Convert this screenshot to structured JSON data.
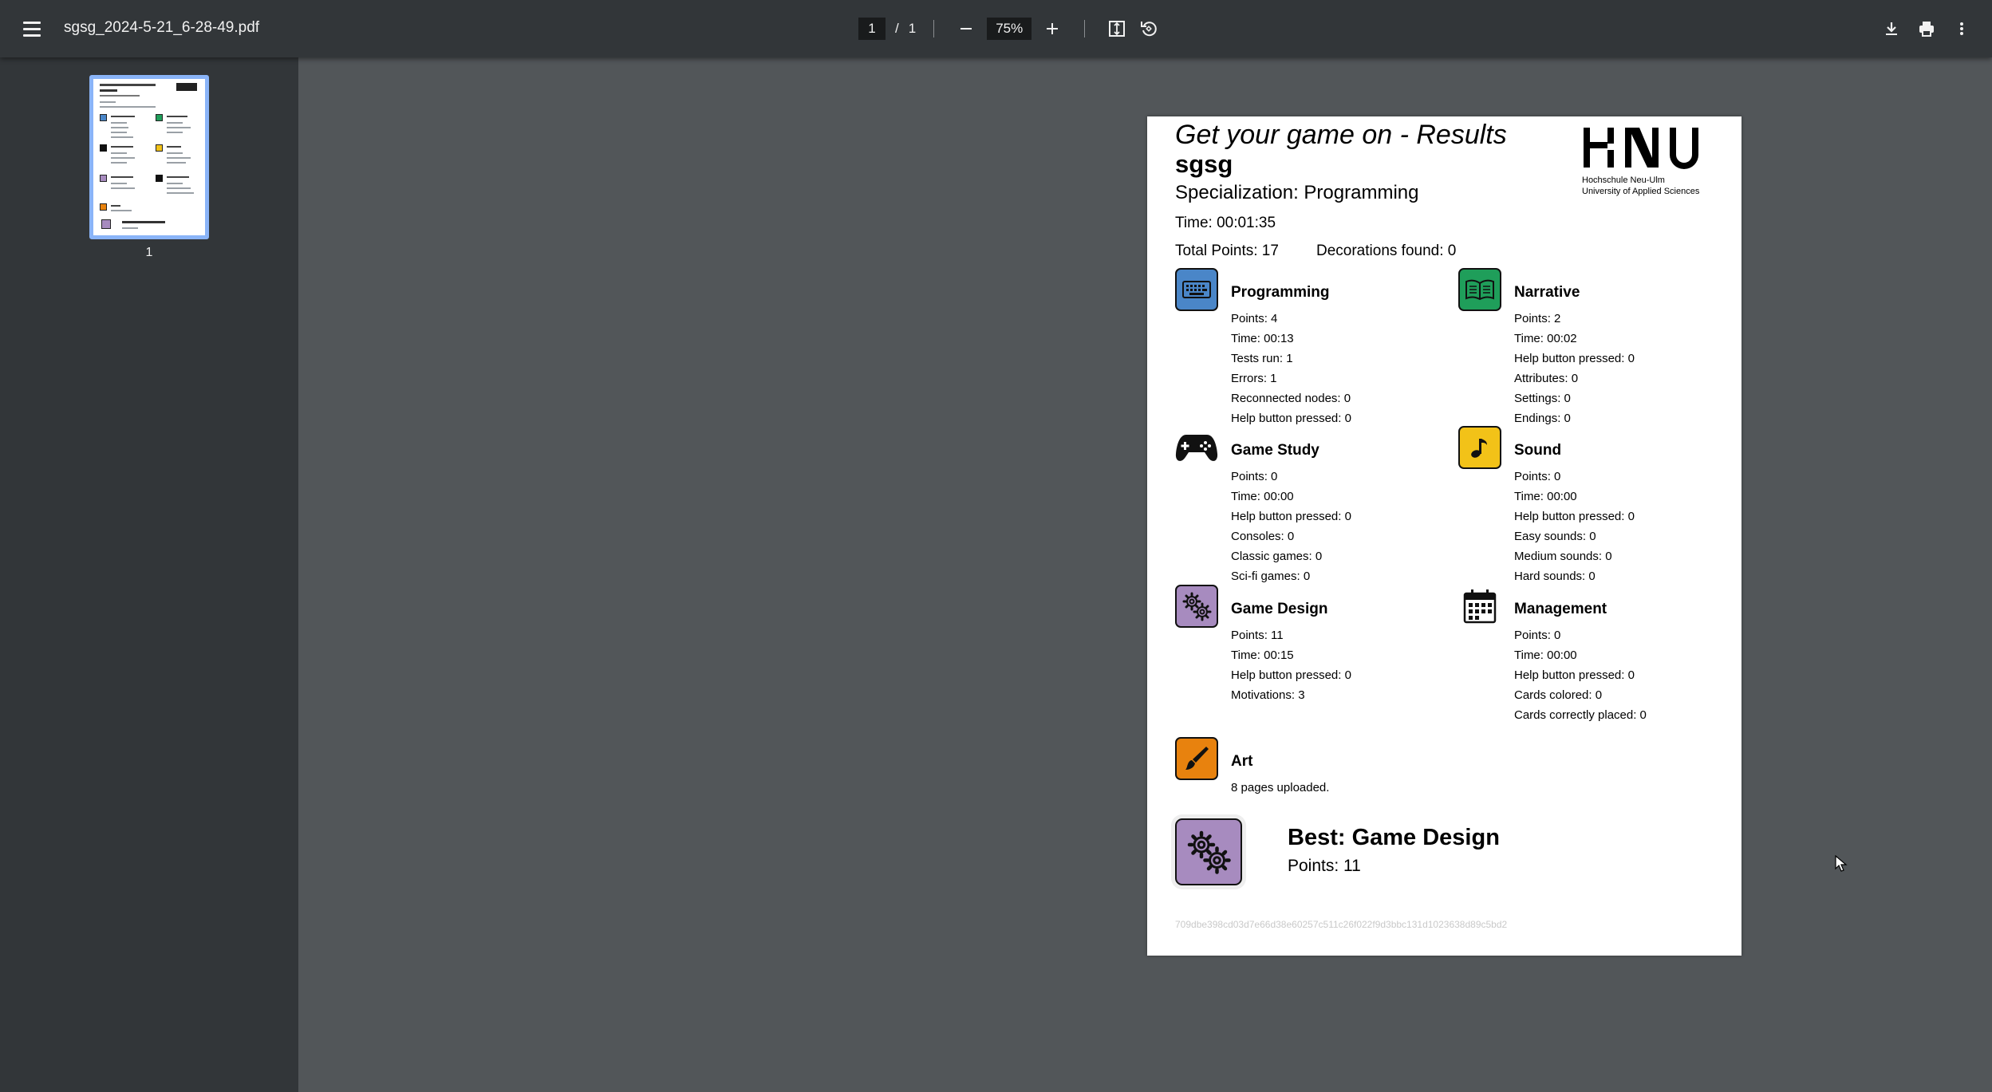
{
  "toolbar": {
    "filename": "sgsg_2024-5-21_6-28-49.pdf",
    "page_current": "1",
    "page_separator": "/",
    "page_total": "1",
    "zoom": "75%"
  },
  "sidebar": {
    "thumbnail_label": "1"
  },
  "document": {
    "heading": "Get your game on - Results",
    "username": "sgsg",
    "specialization": "Specialization: Programming",
    "time": "Time: 00:01:35",
    "total_points": "Total Points: 17",
    "decorations": "Decorations found: 0",
    "logo": {
      "line1": "Hochschule Neu-Ulm",
      "line2": "University of Applied Sciences"
    },
    "categories": {
      "programming": {
        "name": "Programming",
        "color": "#4a86c8",
        "lines": [
          "Points: 4",
          "Time: 00:13",
          "Tests run: 1",
          "Errors: 1",
          "Reconnected nodes: 0",
          "Help button pressed: 0"
        ]
      },
      "narrative": {
        "name": "Narrative",
        "color": "#1f9e5a",
        "lines": [
          "Points: 2",
          "Time: 00:02",
          "Help button pressed: 0",
          "Attributes: 0",
          "Settings: 0",
          "Endings: 0"
        ]
      },
      "game_study": {
        "name": "Game Study",
        "color": "#111111",
        "lines": [
          "Points: 0",
          "Time: 00:00",
          "Help button pressed: 0",
          "Consoles: 0",
          "Classic games: 0",
          "Sci-fi games: 0"
        ]
      },
      "sound": {
        "name": "Sound",
        "color": "#f2c218",
        "lines": [
          "Points: 0",
          "Time: 00:00",
          "Help button pressed: 0",
          "Easy sounds: 0",
          "Medium sounds: 0",
          "Hard sounds: 0"
        ]
      },
      "game_design": {
        "name": "Game Design",
        "color": "#a78bbf",
        "lines": [
          "Points: 11",
          "Time: 00:15",
          "Help button pressed: 0",
          "Motivations: 3"
        ]
      },
      "management": {
        "name": "Management",
        "color": "#111111",
        "lines": [
          "Points: 0",
          "Time: 00:00",
          "Help button pressed: 0",
          "Cards colored: 0",
          "Cards correctly placed: 0"
        ]
      },
      "art": {
        "name": "Art",
        "color": "#e8820e",
        "lines": [
          "8 pages uploaded."
        ]
      }
    },
    "best": {
      "title": "Best: Game Design",
      "points": "Points: 11"
    },
    "hash": "709dbe398cd03d7e66d38e60257c511c26f022f9d3bbc131d1023638d89c5bd2"
  }
}
